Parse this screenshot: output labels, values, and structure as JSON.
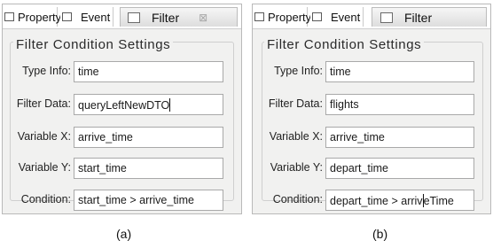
{
  "panels": [
    {
      "tabs": {
        "property": "Property",
        "event": "Event",
        "filter": "Filter",
        "close_glyph": "⊠"
      },
      "group_title": "Filter  Condition  Settings",
      "fields": {
        "type_info": {
          "label": "Type Info:",
          "value": "time"
        },
        "filter_data": {
          "label": "Filter Data:",
          "value": "queryLeftNewDTO"
        },
        "variable_x": {
          "label": "Variable X:",
          "value": "arrive_time"
        },
        "variable_y": {
          "label": "Variable Y:",
          "value": "start_time"
        },
        "condition": {
          "label": "Condition:",
          "value": "start_time > arrive_time"
        }
      },
      "caption": "(a)"
    },
    {
      "tabs": {
        "property": "Property",
        "event": "Event",
        "filter": "Filter"
      },
      "group_title": "Filter  Condition  Settings",
      "fields": {
        "type_info": {
          "label": "Type Info:",
          "value": "time"
        },
        "filter_data": {
          "label": "Filter Data:",
          "value": "flights"
        },
        "variable_x": {
          "label": "Variable X:",
          "value": "arrive_time"
        },
        "variable_y": {
          "label": "Variable Y:",
          "value": "depart_time"
        },
        "condition": {
          "label": "Condition:",
          "value_before_caret": "depart_time > arriv",
          "value_after_caret": "eTime"
        }
      },
      "caption": "(b)"
    }
  ]
}
